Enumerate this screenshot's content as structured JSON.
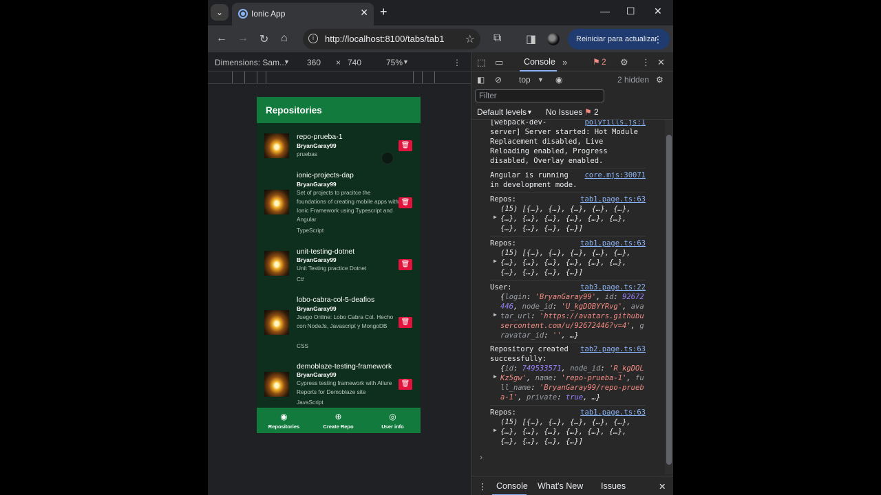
{
  "browser": {
    "tab_title": "Ionic App",
    "url": "http://localhost:8100/tabs/tab1",
    "update_button_label": "Reiniciar para actualizar"
  },
  "device_toolbar": {
    "dimensions_label": "Dimensions: Sam...",
    "width": "360",
    "times": "×",
    "height": "740",
    "zoom": "75%"
  },
  "app": {
    "header_title": "Repositories",
    "repos": [
      {
        "name": "repo-prueba-1",
        "owner": "BryanGaray99",
        "description": "pruebas",
        "language": ""
      },
      {
        "name": "ionic-projects-dap",
        "owner": "BryanGaray99",
        "description": "Set of projects to pracitce the foundations of creating mobile apps with Ionic Framework using Typescript and Angular",
        "language": "TypeScript"
      },
      {
        "name": "unit-testing-dotnet",
        "owner": "BryanGaray99",
        "description": "Unit Testing practice Dotnet",
        "language": "C#"
      },
      {
        "name": "lobo-cabra-col-5-deafios",
        "owner": "BryanGaray99",
        "description": "Juego Online: Lobo Cabra Col. Hecho con NodeJs, Javascript y MongoDB",
        "language": "CSS"
      },
      {
        "name": "demoblaze-testing-framework",
        "owner": "BryanGaray99",
        "description": "Cypress testing framework with Allure Reports for Demoblaze site",
        "language": "JavaScript"
      }
    ],
    "tabs": [
      {
        "label": "Repositories",
        "icon": "github-icon"
      },
      {
        "label": "Create Repo",
        "icon": "add-circle-icon"
      },
      {
        "label": "User info",
        "icon": "person-circle-icon"
      }
    ]
  },
  "devtools": {
    "console_tab": "Console",
    "issues_badge_count": "2",
    "context": "top",
    "hidden_count": "2 hidden",
    "filter_placeholder": "Filter",
    "default_levels": "Default levels",
    "no_issues": "No Issues",
    "no_issues_count": "2",
    "log": {
      "webpack_text": "[webpack-dev-\nserver] Server started: Hot Module\nReplacement disabled, Live\nReloading enabled, Progress\ndisabled, Overlay enabled.",
      "webpack_src": "polyfills.js:1",
      "angular_text": "Angular is running\nin development mode.",
      "angular_src": "core.mjs:30071",
      "repos_label": "Repos:",
      "repos_src": "tab1.page.ts:63",
      "repos_obj": "(15) [{…}, {…}, {…}, {…}, {…},\n{…}, {…}, {…}, {…}, {…}, {…},\n{…}, {…}, {…}, {…}]",
      "user_label": "User:",
      "user_src": "tab3.page.ts:22",
      "repo_created_label": "Repository created\nsuccessfully:",
      "repo_created_src": "tab2.page.ts:63"
    },
    "drawer": {
      "console": "Console",
      "whats_new": "What's New",
      "issues": "Issues"
    }
  }
}
